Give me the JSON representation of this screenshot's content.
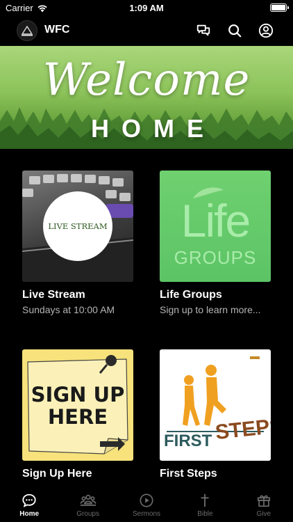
{
  "status_bar": {
    "carrier": "Carrier",
    "time": "1:09 AM"
  },
  "header": {
    "app_name": "WFC",
    "icons": [
      "chat-bubbles-icon",
      "search-icon",
      "account-icon"
    ]
  },
  "banner": {
    "script_text": "Welcome",
    "subtitle": "HOME"
  },
  "tiles": [
    {
      "title": "Live Stream",
      "subtitle": "Sundays at 10:00 AM",
      "image_text": "LIVE STREAM"
    },
    {
      "title": "Life Groups",
      "subtitle": "Sign up to learn more...",
      "image_text_top": "Life",
      "image_text_bottom": "GROUPS"
    },
    {
      "title": "Sign Up Here",
      "subtitle": "",
      "image_text_top": "SIGN UP",
      "image_text_bottom": "HERE"
    },
    {
      "title": "First Steps",
      "subtitle": "",
      "image_text_left": "FIRST",
      "image_text_right": "STEPS"
    }
  ],
  "tab_bar": {
    "active": "Home",
    "items": [
      {
        "label": "Home",
        "icon": "chat-bubble-icon"
      },
      {
        "label": "Groups",
        "icon": "groups-icon"
      },
      {
        "label": "Sermons",
        "icon": "play-circle-icon"
      },
      {
        "label": "Bible",
        "icon": "cross-icon"
      },
      {
        "label": "Give",
        "icon": "gift-icon"
      }
    ]
  },
  "colors": {
    "background": "#000000",
    "accent_green": "#5cc466",
    "sign_up_yellow": "#f7e27b",
    "steps_orange": "#f0a020",
    "steps_brown": "#8a4a1e",
    "muted_text": "#b5b5b5"
  }
}
